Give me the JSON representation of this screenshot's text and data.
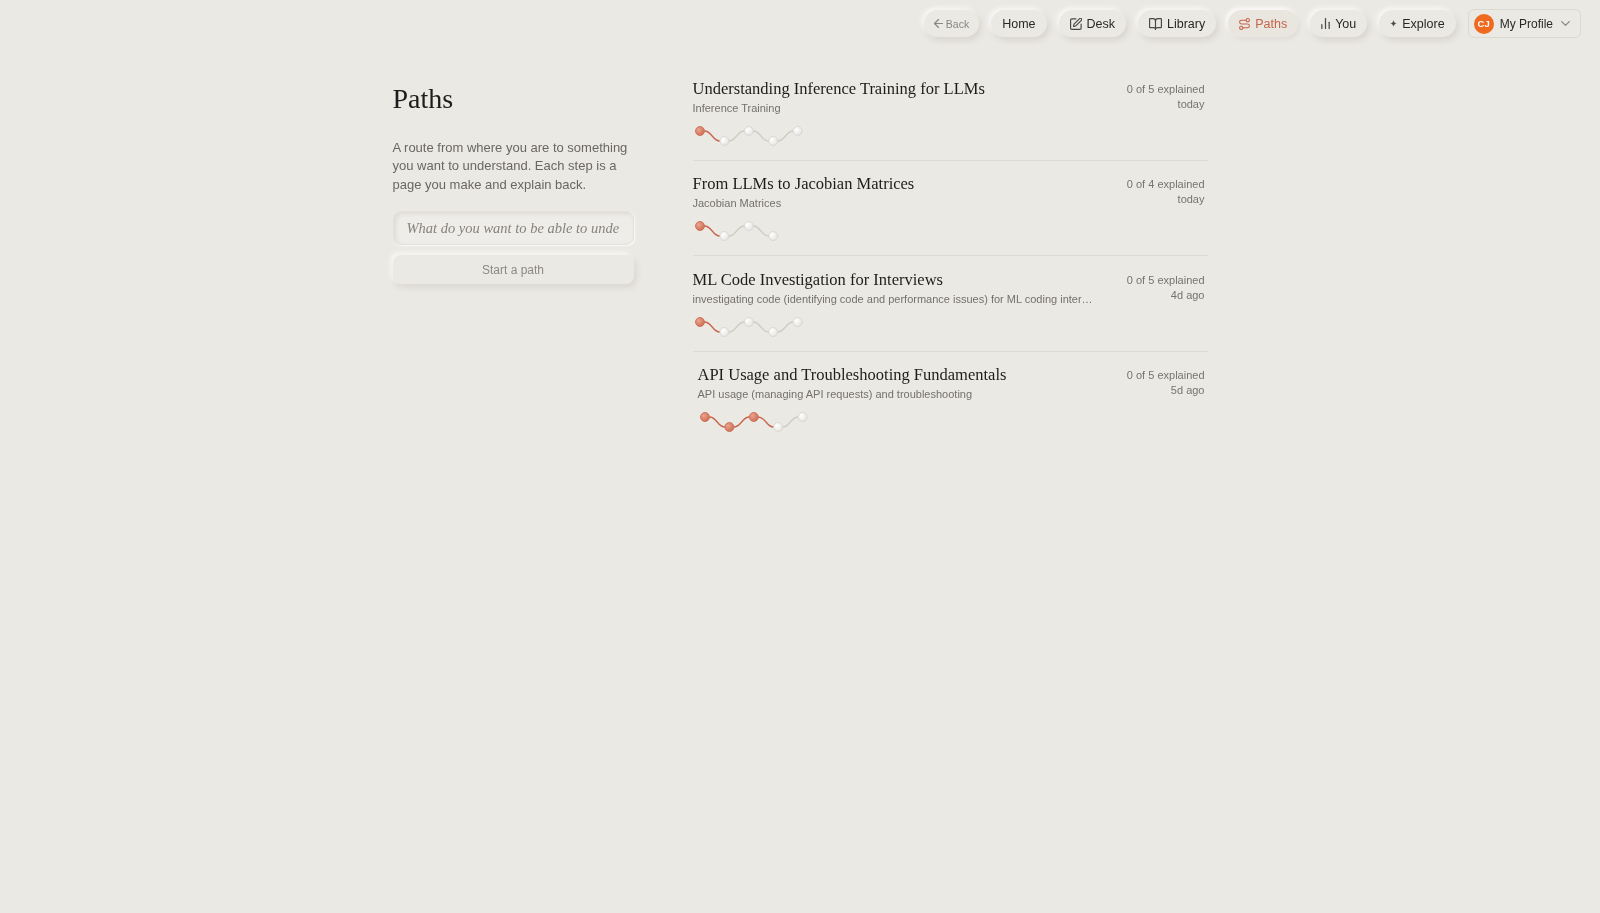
{
  "nav": {
    "items": [
      {
        "kind": "back",
        "label": "Back",
        "selected": false
      },
      {
        "kind": "link",
        "label": "Home",
        "selected": false
      },
      {
        "kind": "link",
        "label": "Desk",
        "selected": false
      },
      {
        "kind": "link",
        "label": "Library",
        "selected": false
      },
      {
        "kind": "link",
        "label": "Paths",
        "selected": true
      },
      {
        "kind": "link",
        "label": "You",
        "selected": false
      },
      {
        "kind": "link",
        "label": "Explore",
        "selected": false
      }
    ],
    "profile": {
      "initials": "CJ",
      "label": "My Profile"
    }
  },
  "sidebar": {
    "title": "Paths",
    "description": "A route from where you are to something you want to understand. Each step is a page you make and explain back.",
    "input": {
      "placeholder": "What do you want to be able to unde"
    },
    "button": {
      "label": "Start a path",
      "disabled": true
    }
  },
  "paths": [
    {
      "title": "Understanding Inference Training for LLMs",
      "subtitle": "Inference Training",
      "progress": "0 of 5 explained",
      "updated": "today",
      "hovered": false,
      "steps": [
        {
          "done": true
        },
        {
          "done": false
        },
        {
          "done": false
        },
        {
          "done": false
        },
        {
          "done": false
        }
      ]
    },
    {
      "title": "From LLMs to Jacobian Matrices",
      "subtitle": "Jacobian Matrices",
      "progress": "0 of 4 explained",
      "updated": "today",
      "hovered": false,
      "steps": [
        {
          "done": true
        },
        {
          "done": false
        },
        {
          "done": false
        },
        {
          "done": false
        }
      ]
    },
    {
      "title": "ML Code Investigation for Interviews",
      "subtitle": "investigating code (identifying code and performance issues) for ML coding inter…",
      "progress": "0 of 5 explained",
      "updated": "4d ago",
      "hovered": false,
      "steps": [
        {
          "done": true
        },
        {
          "done": false
        },
        {
          "done": false
        },
        {
          "done": false
        },
        {
          "done": false
        }
      ]
    },
    {
      "title": "API Usage and Troubleshooting Fundamentals",
      "subtitle": "API usage (managing API requests) and troubleshooting",
      "progress": "0 of 5 explained",
      "updated": "5d ago",
      "hovered": true,
      "steps": [
        {
          "done": true
        },
        {
          "done": true
        },
        {
          "done": true
        },
        {
          "done": false
        },
        {
          "done": false
        }
      ]
    }
  ]
}
